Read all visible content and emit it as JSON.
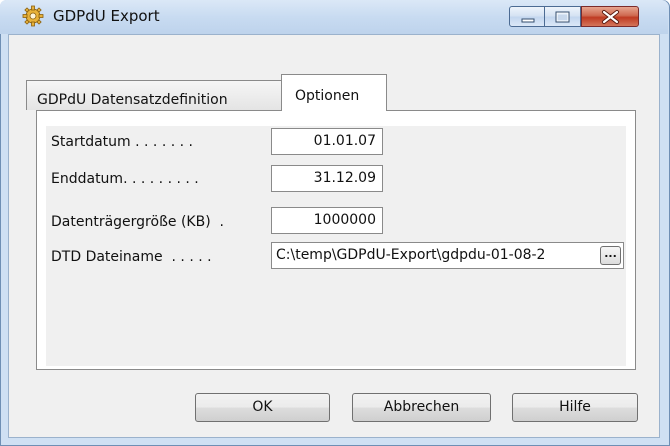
{
  "window": {
    "title": "GDPdU Export",
    "icon": "gear-icon",
    "controls": [
      "minimize-icon",
      "maximize-icon",
      "close-icon"
    ]
  },
  "tabs": [
    {
      "label": "GDPdU Datensatzdefinition",
      "active": false
    },
    {
      "label": "Optionen",
      "active": true
    }
  ],
  "fields": {
    "startdatum": {
      "label": "Startdatum . . . . . . . ",
      "value": "01.01.07"
    },
    "enddatum": {
      "label": "Enddatum. . . . . . . . . ",
      "value": "31.12.09"
    },
    "datentraeger": {
      "label": "Datenträgergröße (KB)  . ",
      "value": "1000000"
    },
    "dtd": {
      "label": "DTD Dateiname  . . . . . ",
      "value": "C:\\temp\\GDPdU-Export\\gdpdu-01-08-2"
    }
  },
  "browse_label": "...",
  "buttons": {
    "ok": "OK",
    "cancel": "Abbrechen",
    "help": "Hilfe"
  }
}
